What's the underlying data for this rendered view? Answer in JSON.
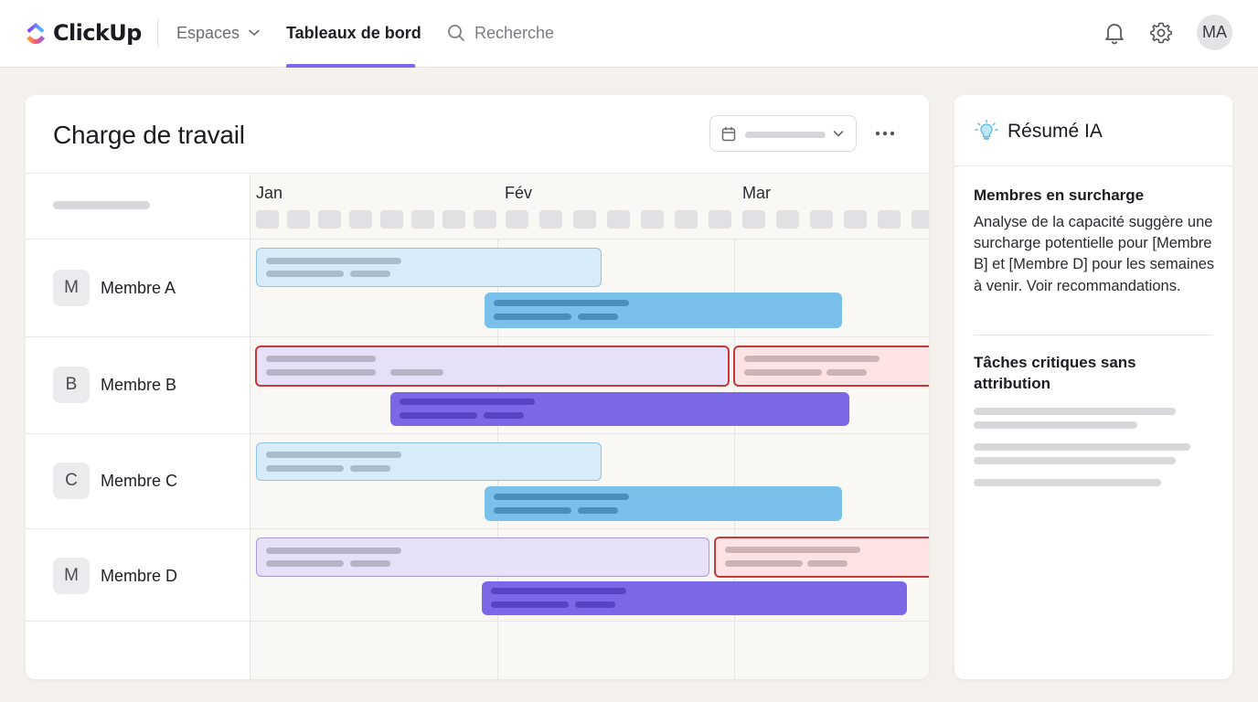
{
  "header": {
    "brand": "ClickUp",
    "nav": {
      "spaces": "Espaces",
      "dashboards": "Tableaux de bord",
      "search": "Recherche"
    },
    "avatar_initials": "MA",
    "icons": [
      "clickup-logo-icon",
      "chevron-down-icon",
      "search-icon",
      "bell-icon",
      "gear-icon"
    ]
  },
  "workload": {
    "title": "Charge de travail",
    "months": [
      "Jan",
      "Fév",
      "Mar"
    ],
    "members": [
      {
        "initial": "M",
        "name": "Membre A"
      },
      {
        "initial": "B",
        "name": "Membre B"
      },
      {
        "initial": "C",
        "name": "Membre C"
      },
      {
        "initial": "M",
        "name": "Membre D"
      }
    ],
    "colors": {
      "accent": "#7b68ee",
      "task_blue": "#79c0ea",
      "task_purple": "#7b68e6",
      "overload": "#c63a3a"
    }
  },
  "ai_summary": {
    "title": "Résumé IA",
    "overload_heading": "Membres en surcharge",
    "overload_text": "Analyse de la capacité suggère une surcharge potentielle pour [Membre B] et [Membre D] pour les semaines à venir. Voir recommandations.",
    "unassigned_heading": "Tâches critiques sans attribution"
  }
}
